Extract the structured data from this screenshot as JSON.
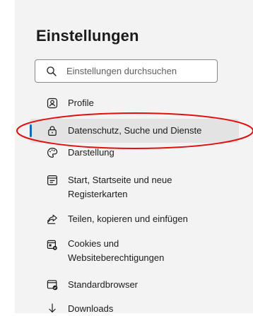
{
  "settings": {
    "title": "Einstellungen"
  },
  "search": {
    "placeholder": "Einstellungen durchsuchen"
  },
  "sidebar": {
    "items": [
      {
        "label": "Profile",
        "icon": "profile-icon"
      },
      {
        "label": "Datenschutz, Suche und Dienste",
        "icon": "lock-icon",
        "active": true
      },
      {
        "label": "Darstellung",
        "icon": "palette-icon"
      },
      {
        "label": "Start, Startseite und neue Registerkarten",
        "icon": "start-page-icon"
      },
      {
        "label": "Teilen, kopieren und einfügen",
        "icon": "share-icon"
      },
      {
        "label": "Cookies und Websiteberechtigungen",
        "icon": "site-permissions-icon"
      },
      {
        "label": "Standardbrowser",
        "icon": "default-browser-icon"
      },
      {
        "label": "Downloads",
        "icon": "download-icon"
      }
    ]
  },
  "annotation": {
    "shape": "ellipse",
    "color": "#e01010",
    "target": "Datenschutz, Suche und Dienste"
  },
  "colors": {
    "accent": "#0f6cbd",
    "panel_bg": "#f3f3f3",
    "active_bg": "#e3e3e3"
  }
}
